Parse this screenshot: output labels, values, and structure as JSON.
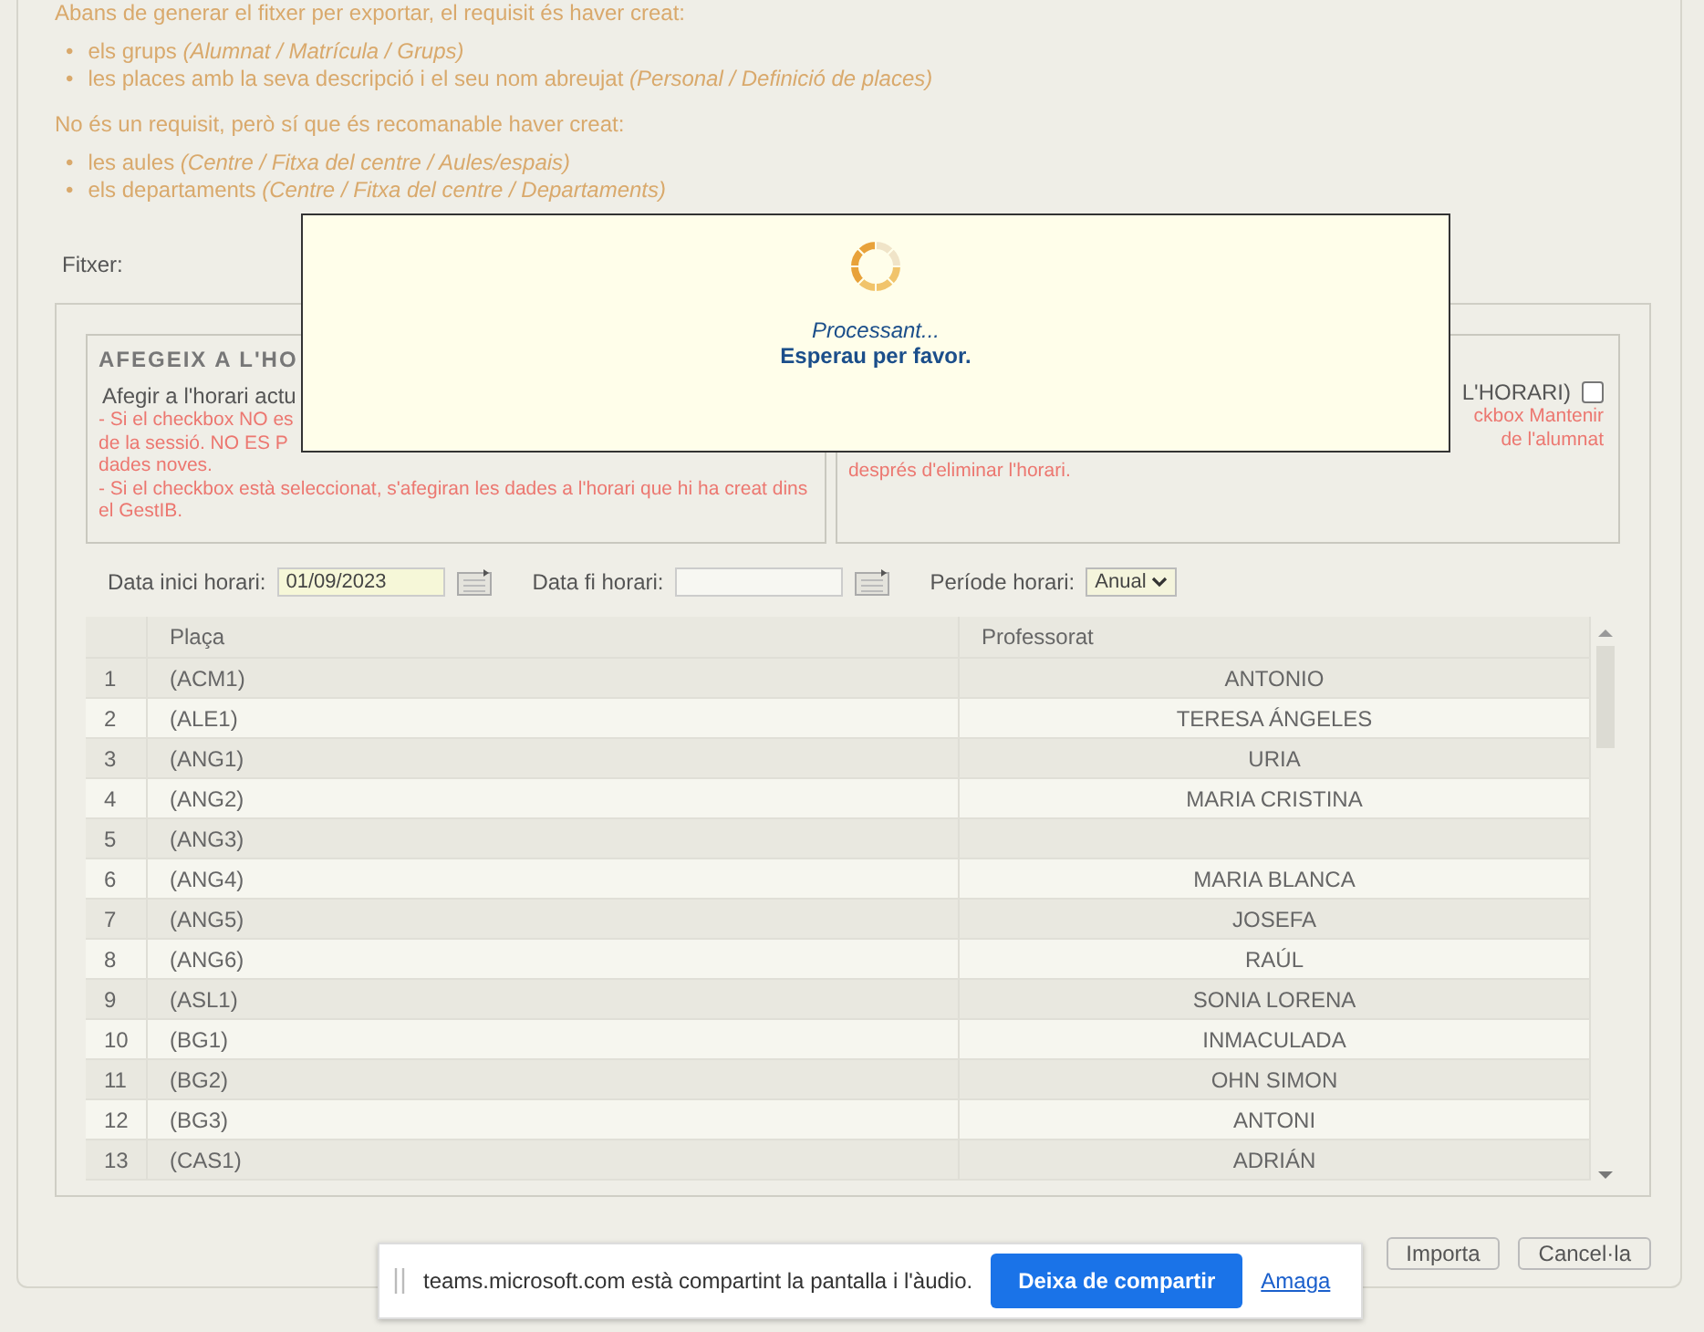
{
  "intro": {
    "heading": "Abans de generar el fitxer per exportar, el requisit és haver creat:",
    "required": [
      {
        "marker": "•",
        "text": "els grups *(Alumnat / Matrícula / Grups)*"
      },
      {
        "marker": "•",
        "text": "les places amb la seva descripció i el seu nom abreujat *(Personal / Definició de places)*"
      }
    ],
    "recommended_heading": "No és un requisit, però sí que és recomanable haver creat:",
    "recommended": [
      {
        "marker": "•",
        "text": "les aules *(Centre / Fitxa del centre / Aules/espais)*"
      },
      {
        "marker": "•",
        "text": "els departaments *(Centre / Fitxa del centre / Departaments)*"
      }
    ]
  },
  "file_label": "Fitxer:",
  "dialog": {
    "title": "Processant...",
    "message": "Esperau per favor."
  },
  "add_section": {
    "legend": "AFEGEIX A L'HO",
    "label": "Afegir a l'horari actu",
    "notes": [
      "- Si el checkbox NO es",
      "de la sessió. NO ES P",
      "dades noves.",
      "- Si el checkbox està seleccionat, s'afegiran les dades a l'horari que hi ha creat dins el GestIB."
    ]
  },
  "keep_section": {
    "label": "L'HORARI)",
    "checked": false,
    "notes": [
      "ckbox Mantenir",
      "de l'alumnat",
      "després d'eliminar l'horari."
    ]
  },
  "dates": {
    "start_label": "Data inici horari:",
    "start_value": "01/09/2023",
    "end_label": "Data fi horari:",
    "period_label": "Període horari:",
    "period_value": "Anual"
  },
  "table": {
    "columns": [
      "Plaça",
      "Professorat"
    ],
    "rows": [
      {
        "index": "1",
        "place": "(ACM1)",
        "teacher": "ANTONIO"
      },
      {
        "index": "2",
        "place": "(ALE1)",
        "teacher": "TERESA ÁNGELES"
      },
      {
        "index": "3",
        "place": "(ANG1)",
        "teacher": "URIA"
      },
      {
        "index": "4",
        "place": "(ANG2)",
        "teacher": "MARIA CRISTINA"
      },
      {
        "index": "5",
        "place": "(ANG3)"
      },
      {
        "index": "6",
        "place": "(ANG4)",
        "teacher": "MARIA BLANCA"
      },
      {
        "index": "7",
        "place": "(ANG5)",
        "teacher": "JOSEFA"
      },
      {
        "index": "8",
        "place": "(ANG6)",
        "teacher": "RAÚL"
      },
      {
        "index": "9",
        "place": "(ASL1)",
        "teacher": "SONIA LORENA"
      },
      {
        "index": "10",
        "place": "(BG1)",
        "teacher": "INMACULADA"
      },
      {
        "index": "11",
        "place": "(BG2)",
        "teacher": "OHN SIMON"
      },
      {
        "index": "12",
        "place": "(BG3)",
        "teacher": "ANTONI"
      },
      {
        "index": "13",
        "place": "(CAS1)",
        "teacher": "ADRIÁN"
      }
    ]
  },
  "buttons": [
    "Importa",
    "Cancel·la"
  ],
  "share_bar": {
    "message": "teams.microsoft.com està compartint la pantalla i l'àudio.",
    "stop_button": "Deixa de compartir",
    "hide_link": "Amaga"
  }
}
